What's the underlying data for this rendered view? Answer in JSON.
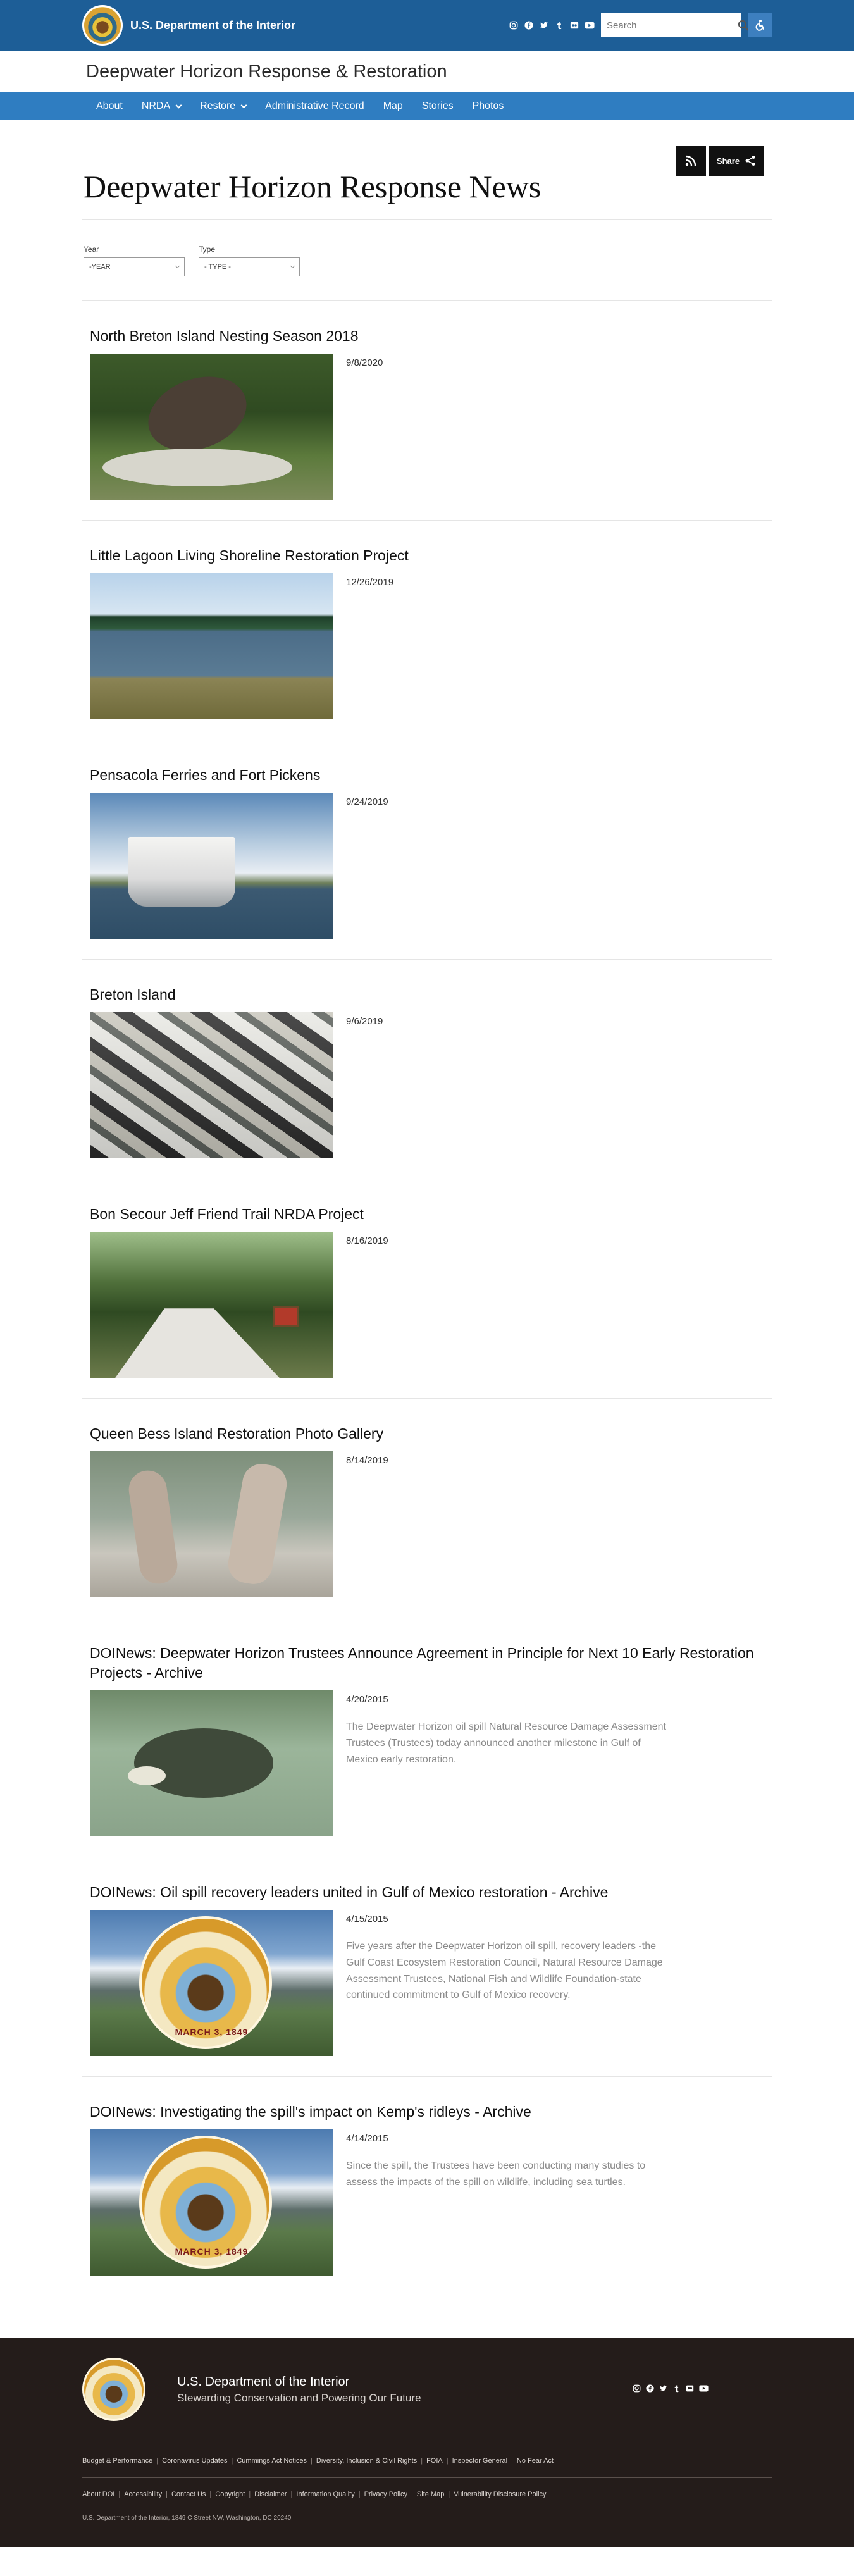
{
  "header": {
    "brand": "U.S. Department of the Interior",
    "social": [
      "instagram-icon",
      "facebook-icon",
      "twitter-icon",
      "tumblr-icon",
      "flickr-icon",
      "youtube-icon"
    ],
    "search": {
      "placeholder": "Search"
    }
  },
  "site_title": "Deepwater Horizon Response & Restoration",
  "nav": {
    "items": [
      {
        "label": "About",
        "dropdown": false
      },
      {
        "label": "NRDA",
        "dropdown": true
      },
      {
        "label": "Restore",
        "dropdown": true
      },
      {
        "label": "Administrative Record",
        "dropdown": false
      },
      {
        "label": "Map",
        "dropdown": false
      },
      {
        "label": "Stories",
        "dropdown": false
      },
      {
        "label": "Photos",
        "dropdown": false
      }
    ]
  },
  "share": {
    "label": "Share"
  },
  "page_title": "Deepwater Horizon Response News",
  "filters": {
    "year": {
      "label": "Year",
      "value": "-YEAR"
    },
    "type": {
      "label": "Type",
      "value": "- TYPE -"
    }
  },
  "articles": [
    {
      "title": "North Breton Island Nesting Season 2018",
      "date": "9/8/2020",
      "desc": ""
    },
    {
      "title": "Little Lagoon Living Shoreline Restoration Project",
      "date": "12/26/2019",
      "desc": ""
    },
    {
      "title": "Pensacola Ferries and Fort Pickens",
      "date": "9/24/2019",
      "desc": ""
    },
    {
      "title": "Breton Island",
      "date": "9/6/2019",
      "desc": ""
    },
    {
      "title": "Bon Secour Jeff Friend Trail NRDA Project",
      "date": "8/16/2019",
      "desc": ""
    },
    {
      "title": "Queen Bess Island Restoration Photo Gallery",
      "date": "8/14/2019",
      "desc": ""
    },
    {
      "title": "DOINews: Deepwater Horizon Trustees Announce Agreement in Principle for Next 10 Early Restoration Projects - Archive",
      "date": "4/20/2015",
      "desc": "The Deepwater Horizon oil spill Natural Resource Damage Assessment Trustees (Trustees) today announced another milestone in Gulf of Mexico early restoration."
    },
    {
      "title": "DOINews: Oil spill recovery leaders united in Gulf of Mexico restoration - Archive",
      "date": "4/15/2015",
      "desc": "Five years after the Deepwater Horizon oil spill, recovery leaders -the Gulf Coast Ecosystem Restoration Council, Natural Resource Damage Assessment Trustees, National Fish and Wildlife Foundation-state continued commitment to Gulf of Mexico recovery."
    },
    {
      "title": "DOINews: Investigating the spill's impact on Kemp's ridleys - Archive",
      "date": "4/14/2015",
      "desc": "Since the spill, the Trustees have been conducting many studies to assess the impacts of the spill on wildlife, including sea turtles."
    }
  ],
  "seal_text": "MARCH 3, 1849",
  "footer": {
    "org_name": "U.S. Department of the Interior",
    "tagline": "Stewarding Conservation and Powering Our Future",
    "links_row1": [
      "Budget & Performance",
      "Coronavirus Updates",
      "Cummings Act Notices",
      "Diversity, Inclusion & Civil Rights",
      "FOIA",
      "Inspector General",
      "No Fear Act"
    ],
    "links_row2": [
      "About DOI",
      "Accessibility",
      "Contact Us",
      "Copyright",
      "Disclaimer",
      "Information Quality",
      "Privacy Policy",
      "Site Map",
      "Vulnerability Disclosure Policy"
    ],
    "address": "U.S. Department of the Interior, 1849 C Street NW, Washington, DC 20240"
  },
  "colors": {
    "header_blue": "#1d5e97",
    "nav_blue": "#2f7dc1",
    "footer_bg": "#241c1a"
  }
}
